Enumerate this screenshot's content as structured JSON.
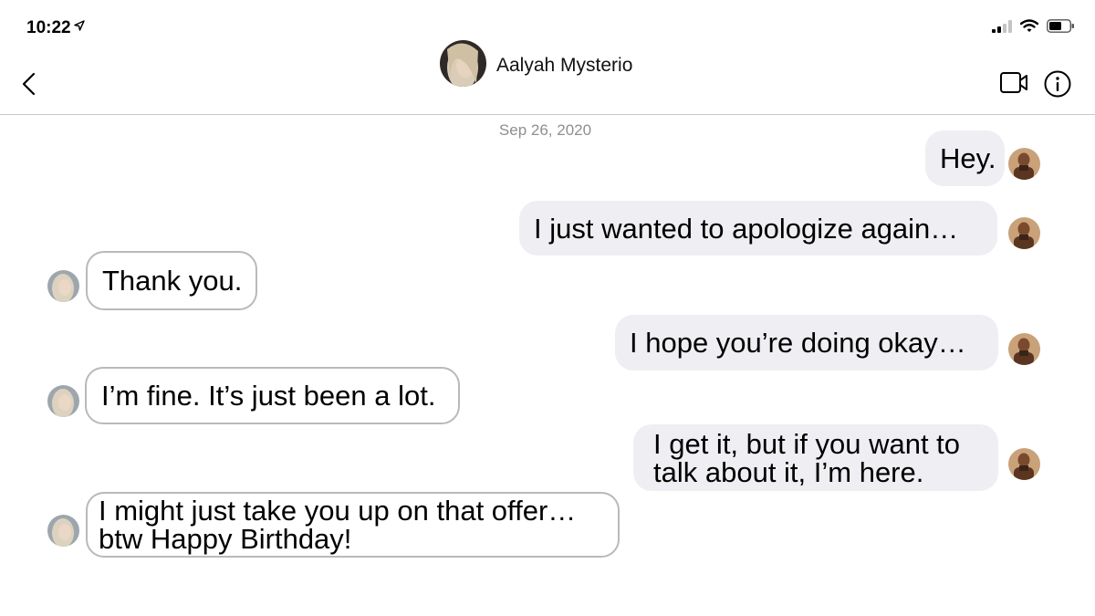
{
  "status_bar": {
    "time": "10:22",
    "location_icon": "location-arrow-icon",
    "signal_icon": "cellular-signal-icon",
    "wifi_icon": "wifi-icon",
    "battery_icon": "battery-icon"
  },
  "header": {
    "back_icon": "chevron-left-icon",
    "contact_name": "Aalyah Mysterio",
    "video_icon": "video-camera-icon",
    "info_icon": "info-icon"
  },
  "conversation": {
    "date": "Sep 26, 2020",
    "messages": [
      {
        "direction": "outgoing",
        "text": "Hey."
      },
      {
        "direction": "outgoing",
        "text": "I just wanted to apologize again…"
      },
      {
        "direction": "incoming",
        "text": "Thank you."
      },
      {
        "direction": "outgoing",
        "text": "I hope you’re doing okay…"
      },
      {
        "direction": "incoming",
        "text": "I’m fine. It’s just been a lot."
      },
      {
        "direction": "outgoing",
        "text": "I get it, but if you want to talk about it, I’m here."
      },
      {
        "direction": "incoming",
        "text": "I might just take you up on that offer… btw Happy Birthday!"
      }
    ]
  },
  "colors": {
    "outgoing_bubble": "#efeef2",
    "incoming_bubble": "#ffffff",
    "incoming_border": "#b9b9bd",
    "date_text": "#8e8e93",
    "divider": "#c8c8cc"
  }
}
